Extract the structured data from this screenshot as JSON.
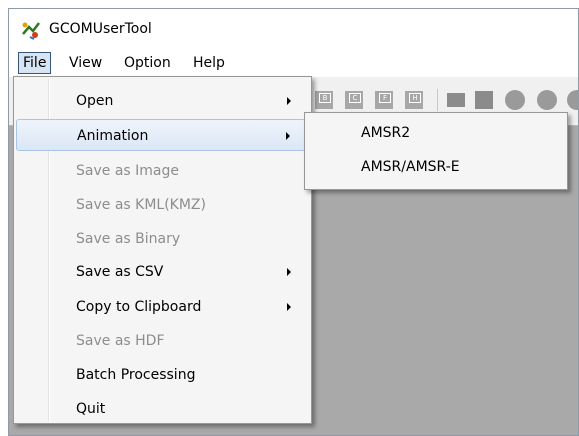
{
  "window": {
    "title": "GCOMUserTool"
  },
  "menubar": {
    "items": [
      "File",
      "View",
      "Option",
      "Help"
    ]
  },
  "toolbar": {
    "buttons": [
      {
        "icon": "grid-icon-b",
        "label": "B"
      },
      {
        "icon": "grid-icon-c",
        "label": "C"
      },
      {
        "icon": "grid-icon-f",
        "label": "F"
      },
      {
        "icon": "grid-icon-h",
        "label": "H"
      }
    ]
  },
  "file_menu": {
    "items": [
      {
        "label": "Open",
        "enabled": true,
        "submenu": true
      },
      {
        "label": "Animation",
        "enabled": true,
        "submenu": true,
        "highlighted": true
      },
      {
        "label": "Save as Image",
        "enabled": false
      },
      {
        "label": "Save as KML(KMZ)",
        "enabled": false
      },
      {
        "label": "Save as Binary",
        "enabled": false
      },
      {
        "label": "Save as CSV",
        "enabled": true,
        "submenu": true
      },
      {
        "label": "Copy to Clipboard",
        "enabled": true,
        "submenu": true
      },
      {
        "label": "Save as HDF",
        "enabled": false
      },
      {
        "label": "Batch Processing",
        "enabled": true
      },
      {
        "label": "Quit",
        "enabled": true
      }
    ]
  },
  "animation_submenu": {
    "items": [
      "AMSR2",
      "AMSR/AMSR-E"
    ]
  },
  "colors": {
    "highlight": "#dbe7f6",
    "disabled_text": "#8d8d8d",
    "workspace": "#a9a9a9"
  }
}
